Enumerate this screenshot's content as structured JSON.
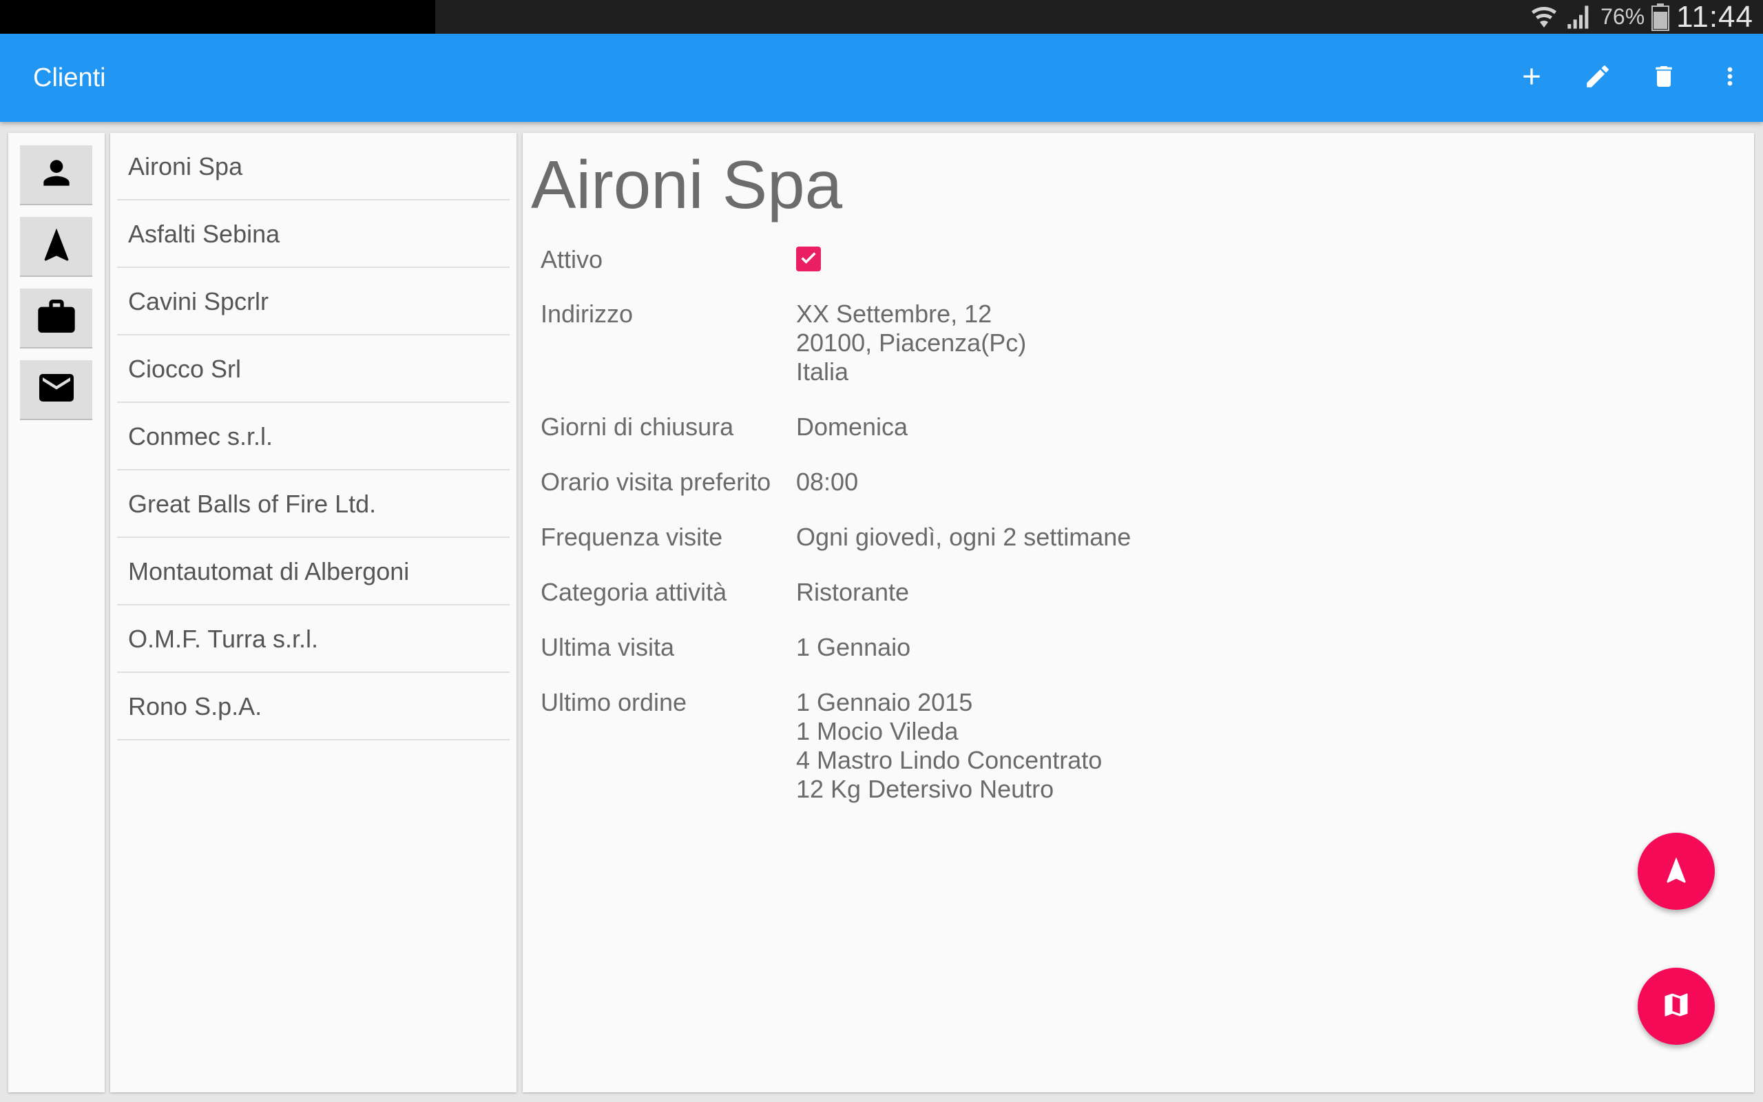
{
  "status_bar": {
    "battery_percent": "76%",
    "time": "11:44",
    "icons": [
      "wifi-icon",
      "signal-icon",
      "battery-icon"
    ]
  },
  "app_bar": {
    "title": "Clienti",
    "actions": [
      "add-icon",
      "edit-icon",
      "delete-icon",
      "overflow-menu-icon"
    ]
  },
  "rail": {
    "buttons": [
      "person-icon",
      "navigation-icon",
      "briefcase-icon",
      "mail-icon"
    ]
  },
  "clients": [
    "Aironi Spa",
    "Asfalti Sebina",
    "Cavini Spcrlr",
    "Ciocco Srl",
    "Conmec s.r.l.",
    "Great Balls of Fire Ltd.",
    "Montautomat di Albergoni",
    "O.M.F. Turra s.r.l.",
    "Rono S.p.A."
  ],
  "detail": {
    "title": "Aironi Spa",
    "active": {
      "label": "Attivo",
      "checked": true
    },
    "address": {
      "label": "Indirizzo",
      "lines": [
        "XX Settembre,  12",
        "20100, Piacenza(Pc)",
        "Italia"
      ]
    },
    "closing_days": {
      "label": "Giorni di chiusura",
      "value": "Domenica"
    },
    "preferred_time": {
      "label": "Orario visita preferito",
      "value": "08:00"
    },
    "visit_frequency": {
      "label": "Frequenza visite",
      "value": "Ogni giovedì, ogni 2 settimane"
    },
    "category": {
      "label": "Categoria attività",
      "value": "Ristorante"
    },
    "last_visit": {
      "label": "Ultima visita",
      "value": "1 Gennaio"
    },
    "last_order": {
      "label": "Ultimo ordine",
      "lines": [
        "1 Gennaio 2015",
        "1 Mocio Vileda",
        "4 Mastro Lindo Concentrato",
        "12 Kg Detersivo Neutro"
      ]
    }
  },
  "fabs": [
    "navigation-icon",
    "map-icon"
  ],
  "colors": {
    "primary": "#2196f3",
    "accent": "#f50a57",
    "status_bar": "#1f1f1f"
  }
}
